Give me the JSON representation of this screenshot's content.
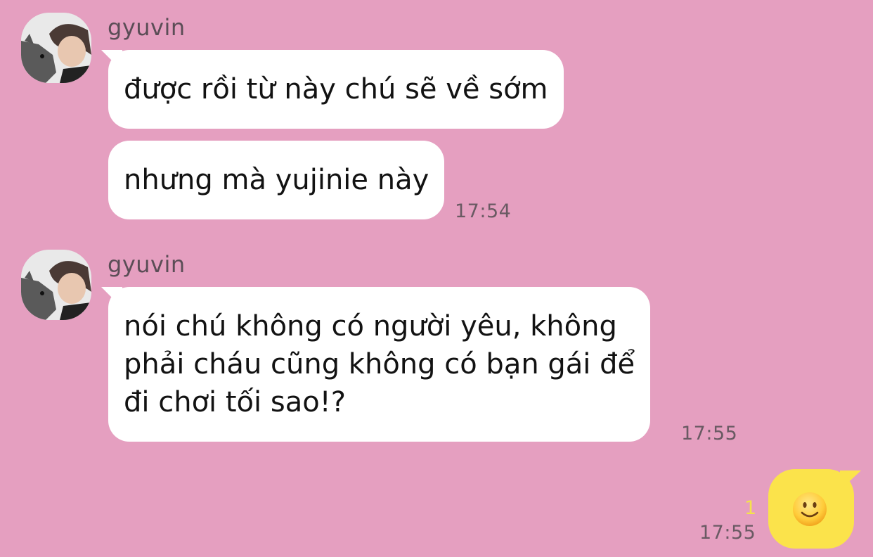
{
  "groups": [
    {
      "sender": "gyuvin",
      "messages": [
        "được rồi từ này chú sẽ về sớm",
        "nhưng mà yujinie này"
      ],
      "time": "17:54"
    },
    {
      "sender": "gyuvin",
      "lines": [
        "nói chú không có người yêu, không",
        "phải cháu cũng không có bạn gái để",
        "đi chơi tối sao!?"
      ],
      "time": "17:55"
    }
  ],
  "my_message": {
    "emoji": "slightly-smiling-face-icon",
    "unread_count": "1",
    "time": "17:55"
  },
  "colors": {
    "background": "#e59fc0",
    "incoming_bubble": "#ffffff",
    "outgoing_bubble": "#fbe34b",
    "unread": "#f4e24b"
  }
}
